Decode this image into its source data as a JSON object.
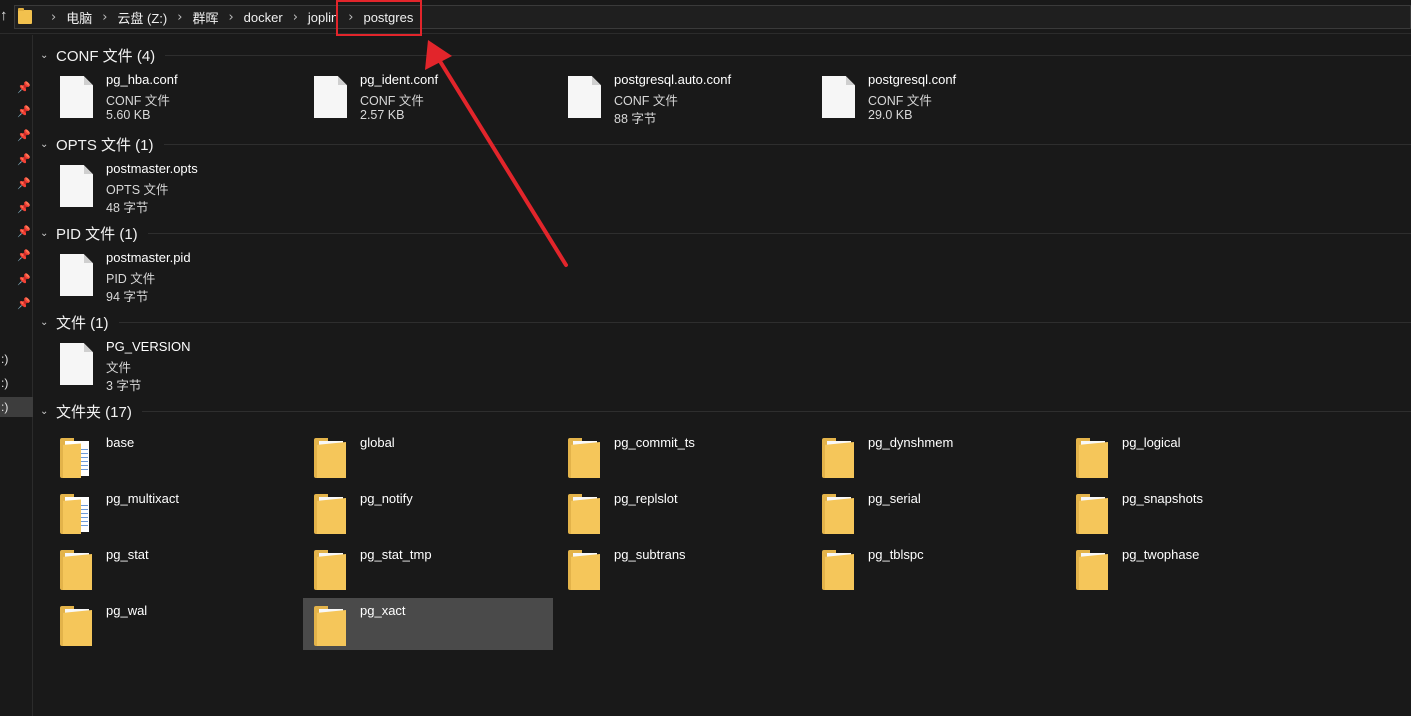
{
  "address_bar": {
    "up_glyph": "↑",
    "breadcrumbs": [
      "电脑",
      "云盘 (Z:)",
      "群晖",
      "docker",
      "joplin",
      "postgres"
    ]
  },
  "nav": {
    "pins": [
      "📌",
      "📌",
      "📌",
      "📌",
      "📌",
      "📌",
      "📌",
      "📌",
      "📌",
      "📌"
    ],
    "drives": [
      ":)",
      ":)",
      ":)"
    ]
  },
  "groups": [
    {
      "title": "CONF 文件 (4)",
      "files": [
        {
          "name": "pg_hba.conf",
          "type": "CONF 文件",
          "size": "5.60 KB"
        },
        {
          "name": "pg_ident.conf",
          "type": "CONF 文件",
          "size": "2.57 KB"
        },
        {
          "name": "postgresql.auto.conf",
          "type": "CONF 文件",
          "size": "88 字节"
        },
        {
          "name": "postgresql.conf",
          "type": "CONF 文件",
          "size": "29.0 KB"
        }
      ]
    },
    {
      "title": "OPTS 文件 (1)",
      "files": [
        {
          "name": "postmaster.opts",
          "type": "OPTS 文件",
          "size": "48 字节"
        }
      ]
    },
    {
      "title": "PID 文件 (1)",
      "files": [
        {
          "name": "postmaster.pid",
          "type": "PID 文件",
          "size": "94 字节"
        }
      ]
    },
    {
      "title": "文件 (1)",
      "files": [
        {
          "name": "PG_VERSION",
          "type": "文件",
          "size": "3 字节"
        }
      ]
    }
  ],
  "folder_group": {
    "title": "文件夹 (17)",
    "folders": [
      {
        "name": "base",
        "docs": true
      },
      {
        "name": "global",
        "docs": false
      },
      {
        "name": "pg_commit_ts",
        "docs": false
      },
      {
        "name": "pg_dynshmem",
        "docs": false
      },
      {
        "name": "pg_logical",
        "docs": false
      },
      {
        "name": "pg_multixact",
        "docs": true
      },
      {
        "name": "pg_notify",
        "docs": false
      },
      {
        "name": "pg_replslot",
        "docs": false
      },
      {
        "name": "pg_serial",
        "docs": false
      },
      {
        "name": "pg_snapshots",
        "docs": false
      },
      {
        "name": "pg_stat",
        "docs": false
      },
      {
        "name": "pg_stat_tmp",
        "docs": false
      },
      {
        "name": "pg_subtrans",
        "docs": false
      },
      {
        "name": "pg_tblspc",
        "docs": false
      },
      {
        "name": "pg_twophase",
        "docs": false
      },
      {
        "name": "pg_wal",
        "docs": false
      },
      {
        "name": "pg_xact",
        "docs": false,
        "selected": true
      }
    ]
  },
  "annotation_color": "#e2252b"
}
